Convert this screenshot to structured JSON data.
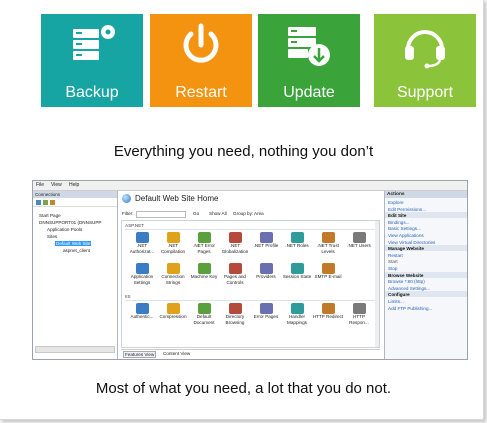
{
  "tiles": [
    {
      "label": "Backup",
      "icon": "server-gear-icon",
      "color": "#17a5a3"
    },
    {
      "label": "Restart",
      "icon": "power-icon",
      "color": "#f4930f"
    },
    {
      "label": "Update",
      "icon": "server-download-icon",
      "color": "#3aa43a"
    },
    {
      "label": "Support",
      "icon": "headset-icon",
      "color": "#8bc43a"
    }
  ],
  "caption_top": "Everything you need, nothing you don’t",
  "caption_bottom": "Most of what you need, a lot that you do not.",
  "iis": {
    "menu": [
      "File",
      "View",
      "Help"
    ],
    "connections": {
      "header": "Connections",
      "tree": [
        "Start Page",
        "DNNSUPPORT01 (DNNSUPP",
        "Application Pools",
        "Sites",
        "Default Web Site",
        "aspnet_client"
      ]
    },
    "title": "Default Web Site Home",
    "filter": {
      "label": "Filter:",
      "go": "Go",
      "show_all": "Show All",
      "group_by": "Group by:",
      "group_value": "Area"
    },
    "group1": "ASP.NET",
    "row1": [
      ".NET Authorizat...",
      ".NET Compilation",
      ".NET Error Pages",
      ".NET Globalization",
      ".NET Profile",
      ".NET Roles",
      ".NET Trust Levels",
      ".NET Users"
    ],
    "row2": [
      "Application Settings",
      "Connection Strings",
      "Machine Key",
      "Pages and Controls",
      "Providers",
      "Session State",
      "SMTP E-mail"
    ],
    "group2": "IIS",
    "row3": [
      "Authentic...",
      "Compression",
      "Default Document",
      "Directory Browsing",
      "Error Pages",
      "Handler Mappings",
      "HTTP Redirect",
      "HTTP Respon..."
    ],
    "views": {
      "features": "Features View",
      "content": "Content View"
    },
    "actions": {
      "header": "Actions",
      "items": [
        {
          "text": "Explore",
          "style": "l"
        },
        {
          "text": "Edit Permissions...",
          "style": "l"
        },
        {
          "text": "Edit Site",
          "style": "b"
        },
        {
          "text": "Bindings...",
          "style": "l"
        },
        {
          "text": "Basic Settings...",
          "style": "l"
        },
        {
          "text": "View Applications",
          "style": "l"
        },
        {
          "text": "View Virtual Directories",
          "style": "l"
        },
        {
          "text": "Manage Website",
          "style": "b"
        },
        {
          "text": "Restart",
          "style": "l"
        },
        {
          "text": "Start",
          "style": "g"
        },
        {
          "text": "Stop",
          "style": "l"
        },
        {
          "text": "Browse Website",
          "style": "b"
        },
        {
          "text": "Browse *:80 (http)",
          "style": "l"
        },
        {
          "text": "Advanced Settings...",
          "style": "l"
        },
        {
          "text": "Configure",
          "style": "b"
        },
        {
          "text": "Limits...",
          "style": "l"
        },
        {
          "text": "Add FTP Publishing...",
          "style": "l"
        }
      ]
    }
  }
}
